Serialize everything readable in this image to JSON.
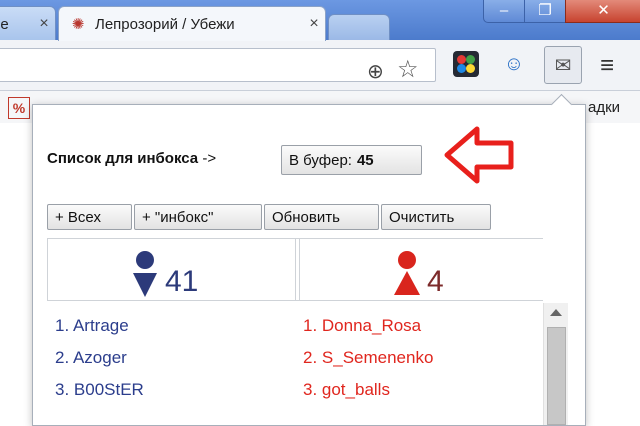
{
  "tabs": {
    "prev_title": "le",
    "prev_close": "×",
    "active_title": "Лепрозорий / Убежи",
    "active_close": "×",
    "active_favicon": "bug-icon"
  },
  "window_buttons": {
    "minimize": "–",
    "maximize": "❐",
    "close": "✕"
  },
  "toolbar": {
    "zoom_icon": "zoom-icon",
    "bookmark_star_icon": "star-icon",
    "extensions": [
      "color-ext-icon",
      "user-sync-ext-icon",
      "mail-ext-icon"
    ],
    "menu_icon": "hamburger-menu-icon"
  },
  "bookmarks": {
    "partial_label": "адки"
  },
  "popup": {
    "inbox_label": "Список для инбокса",
    "inbox_arrow_text": " ->",
    "buffer_button_label": "В буфер:",
    "buffer_count": "45",
    "buttons": {
      "add_all": "+ Всех",
      "add_inbox": "+ \"инбокс\"",
      "refresh": "Обновить",
      "clear": "Очистить"
    },
    "male_count": "41",
    "female_count": "4",
    "male_users": [
      "1. Artrage",
      "2. Azoger",
      "3. B00StER"
    ],
    "female_users": [
      "1. Donna_Rosa",
      "2. S_Semenenko",
      "3. got_balls"
    ],
    "colors": {
      "male": "#2b3d8c",
      "female": "#e0261e",
      "annotation_arrow": "#e8201c"
    }
  }
}
